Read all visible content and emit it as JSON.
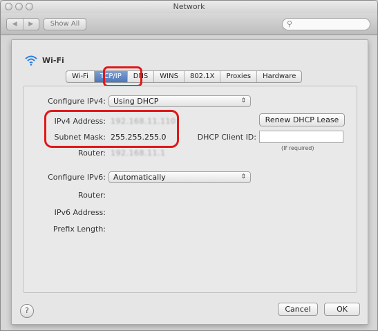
{
  "window": {
    "title": "Network"
  },
  "toolbar": {
    "back": "◀",
    "forward": "▶",
    "show_all": "Show All",
    "search_placeholder": ""
  },
  "interface": {
    "name": "Wi-Fi"
  },
  "tabs": [
    {
      "label": "Wi-Fi"
    },
    {
      "label": "TCP/IP",
      "active": true
    },
    {
      "label": "DNS"
    },
    {
      "label": "WINS"
    },
    {
      "label": "802.1X"
    },
    {
      "label": "Proxies"
    },
    {
      "label": "Hardware"
    }
  ],
  "ipv4": {
    "configure_label": "Configure IPv4:",
    "configure_value": "Using DHCP",
    "address_label": "IPv4 Address:",
    "address_value": "192.168.11.110",
    "subnet_label": "Subnet Mask:",
    "subnet_value": "255.255.255.0",
    "router_label": "Router:",
    "router_value": "192.168.11.1",
    "renew_button": "Renew DHCP Lease",
    "client_id_label": "DHCP Client ID:",
    "client_id_value": "",
    "client_id_hint": "(If required)"
  },
  "ipv6": {
    "configure_label": "Configure IPv6:",
    "configure_value": "Automatically",
    "router_label": "Router:",
    "address_label": "IPv6 Address:",
    "prefix_label": "Prefix Length:"
  },
  "footer": {
    "help": "?",
    "cancel": "Cancel",
    "ok": "OK"
  },
  "colors": {
    "highlight": "#e01818",
    "active_tab": "#5a80c0"
  }
}
